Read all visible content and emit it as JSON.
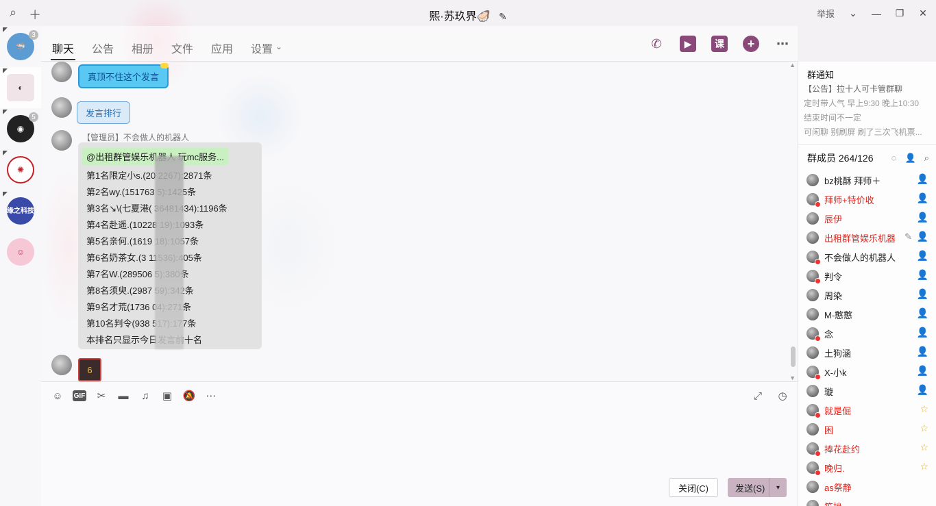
{
  "window": {
    "title": "熙·苏玖界🦪",
    "report_label": "举报"
  },
  "dock": {
    "badges": [
      "3",
      "",
      "5"
    ],
    "items": [
      {
        "color": "#4a90c9",
        "label": ""
      },
      {
        "color": "#d94b67",
        "label": ""
      },
      {
        "color": "#222222",
        "label": ""
      },
      {
        "color": "#c32027",
        "label": ""
      },
      {
        "color": "#3a4aa8",
        "label": "缘之科技"
      },
      {
        "color": "#f6c8d6",
        "label": ""
      }
    ]
  },
  "tabs": [
    {
      "label": "聊天",
      "active": true
    },
    {
      "label": "公告"
    },
    {
      "label": "相册"
    },
    {
      "label": "文件"
    },
    {
      "label": "应用"
    },
    {
      "label": "设置"
    }
  ],
  "tab_icons": {
    "course_label": "课"
  },
  "messages": {
    "m1": "真顶不住这个发言",
    "m2": "发言排行",
    "sender_role": "【管理员】",
    "sender_name": "不会做人的机器人",
    "mention": "@出租群管娱乐机器人 玩mc服务...",
    "ranks": [
      "第1名限定小s.(20      2267):2871条",
      "第2名wy.(151763      5):1425条",
      "第3名↘\\(七夏港(     36481434):1196条",
      "第4名赴遥.(10228      19):1093条",
      "第5名亲何.(1619      18):1057条",
      "第6名奶茶女.(3      11536):405条",
      "第7名W.(289506      5):380条",
      "第8名须臾.(2987      59):342条",
      "第9名才荒(1736      04):271条",
      "第10名判令(938      517):177条",
      "本排名只显示今日发言前十名"
    ],
    "sticker_text": "6"
  },
  "composer": {
    "gif_label": "GIF",
    "close_label": "关闭(C)",
    "send_label": "发送(S)"
  },
  "notice": {
    "title": "群通知",
    "lines": [
      "【公告】拉十人可卡管群聊",
      "定时带人气 早上9:30 晚上10:30",
      "结束时间不一定",
      "可闲聊 别刷屏 刷了三次飞机票..."
    ]
  },
  "members": {
    "header": "群成员 264/126",
    "list": [
      {
        "name": "bz桃酥 拜师＋",
        "red": false,
        "ban": false,
        "badge": "green"
      },
      {
        "name": "拜师+特价收",
        "red": true,
        "ban": true,
        "badge": "green"
      },
      {
        "name": "辰伊",
        "red": true,
        "ban": false,
        "badge": "green"
      },
      {
        "name": "出租群管娱乐机器",
        "red": true,
        "ban": false,
        "badge": "green",
        "edit": true
      },
      {
        "name": "不会做人的机器人",
        "red": false,
        "ban": true,
        "badge": "green"
      },
      {
        "name": "判令",
        "red": false,
        "ban": true,
        "badge": "green"
      },
      {
        "name": "周染",
        "red": false,
        "ban": false,
        "badge": "green"
      },
      {
        "name": "M-憨憨",
        "red": false,
        "ban": false,
        "badge": "green"
      },
      {
        "name": "念",
        "red": false,
        "ban": true,
        "badge": "green"
      },
      {
        "name": "土狗涵",
        "red": false,
        "ban": false,
        "badge": "green"
      },
      {
        "name": "X-小k",
        "red": false,
        "ban": true,
        "badge": "green"
      },
      {
        "name": "璇",
        "red": false,
        "ban": false,
        "badge": "green"
      },
      {
        "name": "就是倔",
        "red": true,
        "ban": true,
        "badge": "gold"
      },
      {
        "name": "困",
        "red": true,
        "ban": false,
        "badge": "gold"
      },
      {
        "name": "捧花赴约",
        "red": true,
        "ban": true,
        "badge": "gold"
      },
      {
        "name": "晚归.",
        "red": true,
        "ban": true,
        "badge": "gold"
      },
      {
        "name": "as祭静",
        "red": true,
        "ban": false,
        "badge": ""
      },
      {
        "name": "笙挫",
        "red": true,
        "ban": false,
        "badge": ""
      }
    ]
  },
  "colors": {
    "accent": "#8a4a79",
    "red_name": "#e2231a",
    "admin_badge": "#55b050",
    "owner_badge": "#e8b41e"
  }
}
